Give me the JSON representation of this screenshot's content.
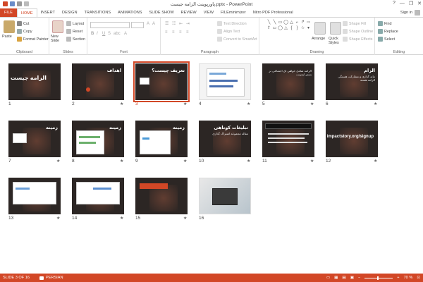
{
  "window": {
    "title": "پاورپوینت الزامه جیست.pptx - PowerPoint",
    "controls": [
      "?",
      "—",
      "❐",
      "✕"
    ]
  },
  "tabs": [
    "FILE",
    "HOME",
    "INSERT",
    "DESIGN",
    "TRANSITIONS",
    "ANIMATIONS",
    "SLIDE SHOW",
    "REVIEW",
    "VIEW",
    "FILEminimizer",
    "Nitro PDF Professional"
  ],
  "signin": "Sign in",
  "ribbon": {
    "clipboard": {
      "label": "Clipboard",
      "paste": "Paste",
      "cut": "Cut",
      "copy": "Copy",
      "format_painter": "Format Painter"
    },
    "slides": {
      "label": "Slides",
      "new_slide": "New Slide",
      "layout": "Layout",
      "reset": "Reset",
      "section": "Section"
    },
    "font": {
      "label": "Font"
    },
    "paragraph": {
      "label": "Paragraph",
      "text_direction": "Text Direction",
      "align_text": "Align Text",
      "smartart": "Convert to SmartArt"
    },
    "drawing": {
      "label": "Drawing",
      "arrange": "Arrange",
      "quick_styles": "Quick Styles",
      "shape_fill": "Shape Fill",
      "shape_outline": "Shape Outline",
      "shape_effects": "Shape Effects"
    },
    "editing": {
      "label": "Editing",
      "find": "Find",
      "replace": "Replace",
      "select": "Select"
    }
  },
  "slides": [
    {
      "n": "1",
      "heading": "الزامه جیست",
      "body": ""
    },
    {
      "n": "2",
      "heading": "اهداف",
      "body": ""
    },
    {
      "n": "3",
      "heading": "تعریف چیست؟",
      "body": ""
    },
    {
      "n": "4",
      "heading": "",
      "body": ""
    },
    {
      "n": "5",
      "heading": "",
      "body": "الزامه شامل خواهی ای اجتماعی بر بستر اینترنت"
    },
    {
      "n": "6",
      "heading": "الزام",
      "body": "مایه گذاری و مشارکت هستگی الزامه هسته"
    },
    {
      "n": "7",
      "heading": "زمینه",
      "body": ""
    },
    {
      "n": "8",
      "heading": "زمینه",
      "body": ""
    },
    {
      "n": "9",
      "heading": "زمینه",
      "body": ""
    },
    {
      "n": "10",
      "heading": "تبلیغات کوتاهی",
      "body": "مقاله مجموعه اشتراک گذاری"
    },
    {
      "n": "11",
      "heading": "",
      "body": ""
    },
    {
      "n": "12",
      "heading": "impactstory.org/signup",
      "body": ""
    },
    {
      "n": "13",
      "heading": "",
      "body": ""
    },
    {
      "n": "14",
      "heading": "",
      "body": ""
    },
    {
      "n": "15",
      "heading": "",
      "body": ""
    },
    {
      "n": "16",
      "heading": "",
      "body": ""
    }
  ],
  "status": {
    "slide_counter": "SLIDE 3 OF 16",
    "language": "PERSIAN",
    "zoom": "70 %"
  },
  "colors": {
    "accent": "#d24726"
  }
}
